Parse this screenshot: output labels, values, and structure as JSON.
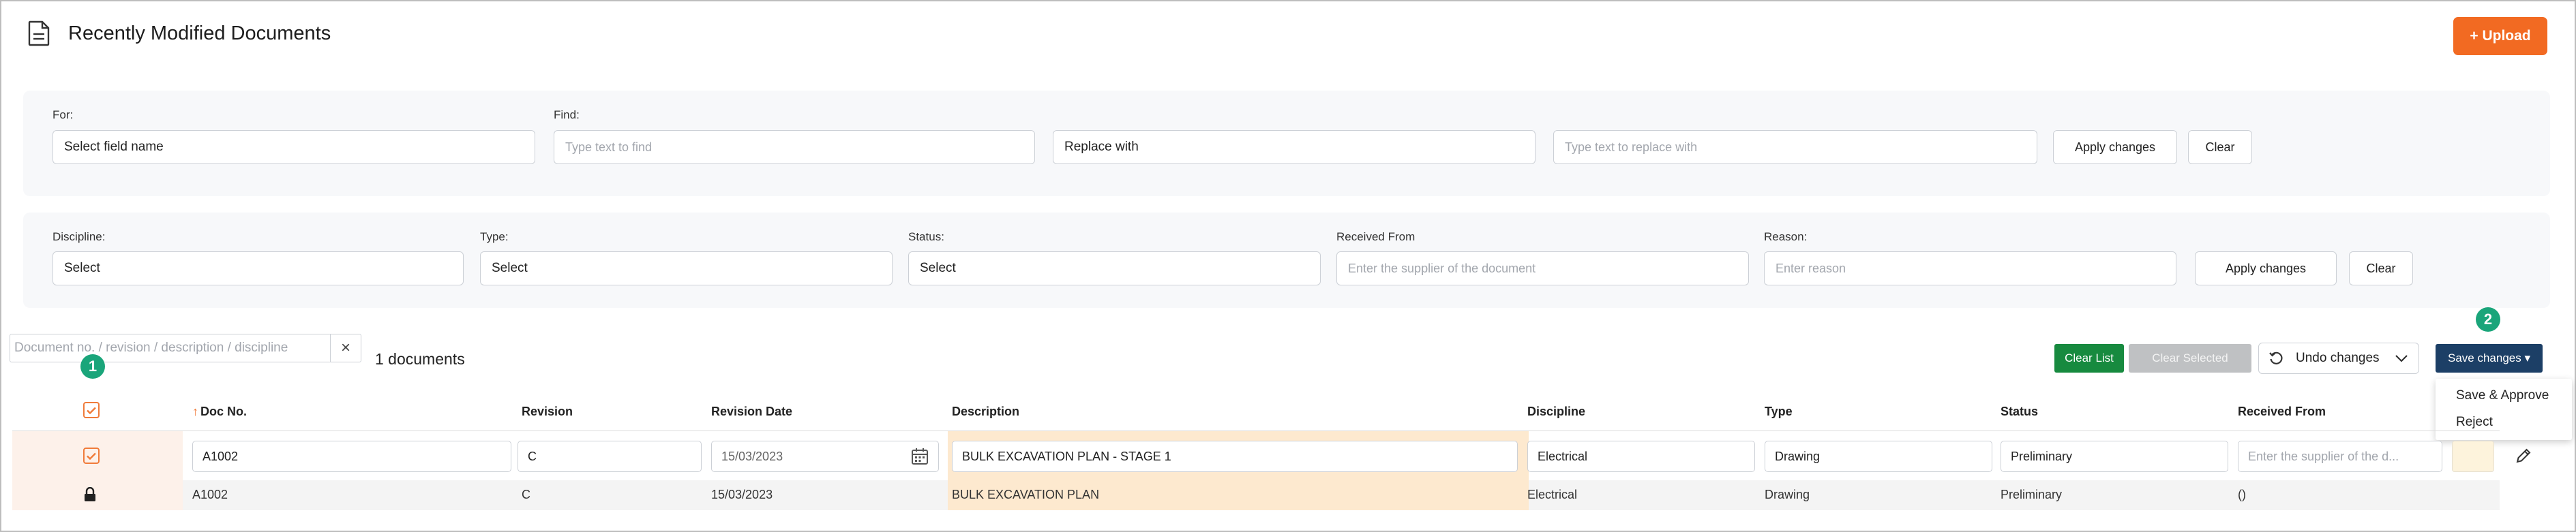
{
  "header": {
    "title": "Recently Modified Documents",
    "upload_label": "+ Upload"
  },
  "find_replace": {
    "for_label": "For:",
    "for_value": "Select field name",
    "find_label": "Find:",
    "find_placeholder": "Type text to find",
    "replace_value": "Replace with",
    "replace_placeholder": "Type text to replace with",
    "apply_label": "Apply changes",
    "clear_label": "Clear"
  },
  "filters": {
    "discipline_label": "Discipline:",
    "discipline_value": "Select",
    "type_label": "Type:",
    "type_value": "Select",
    "status_label": "Status:",
    "status_value": "Select",
    "received_label": "Received From",
    "received_placeholder": "Enter the supplier of the document",
    "reason_label": "Reason:",
    "reason_placeholder": "Enter reason",
    "apply_label": "Apply changes",
    "clear_label": "Clear"
  },
  "toolbar": {
    "search_placeholder": "Document no. / revision / description / discipline",
    "doc_count": "1 documents",
    "clear_list": "Clear List",
    "clear_selected": "Clear Selected",
    "undo_label": "Undo changes",
    "save_label": "Save changes ▾",
    "badge1": "1",
    "badge2": "2"
  },
  "save_menu": [
    "Save & Approve",
    "Reject"
  ],
  "table": {
    "columns": {
      "doc_no": "Doc No.",
      "revision": "Revision",
      "revision_date": "Revision Date",
      "description": "Description",
      "discipline": "Discipline",
      "type": "Type",
      "status": "Status",
      "received_from": "Received From"
    },
    "edit_row": {
      "doc_no": "A1002",
      "revision": "C",
      "revision_date": "15/03/2023",
      "description": "BULK EXCAVATION PLAN - STAGE 1",
      "discipline": "Electrical",
      "type": "Drawing",
      "status": "Preliminary",
      "received_placeholder": "Enter the supplier of the d..."
    },
    "orig_row": {
      "doc_no": "A1002",
      "revision": "C",
      "revision_date": "15/03/2023",
      "description": "BULK EXCAVATION PLAN",
      "discipline": "Electrical",
      "type": "Drawing",
      "status": "Preliminary",
      "received_from": "()"
    }
  },
  "colors": {
    "accent": "#f26a22",
    "primary": "#1c3f66",
    "success": "#178a3f",
    "highlight": "#fde9cf",
    "badge": "#1aa57a"
  }
}
